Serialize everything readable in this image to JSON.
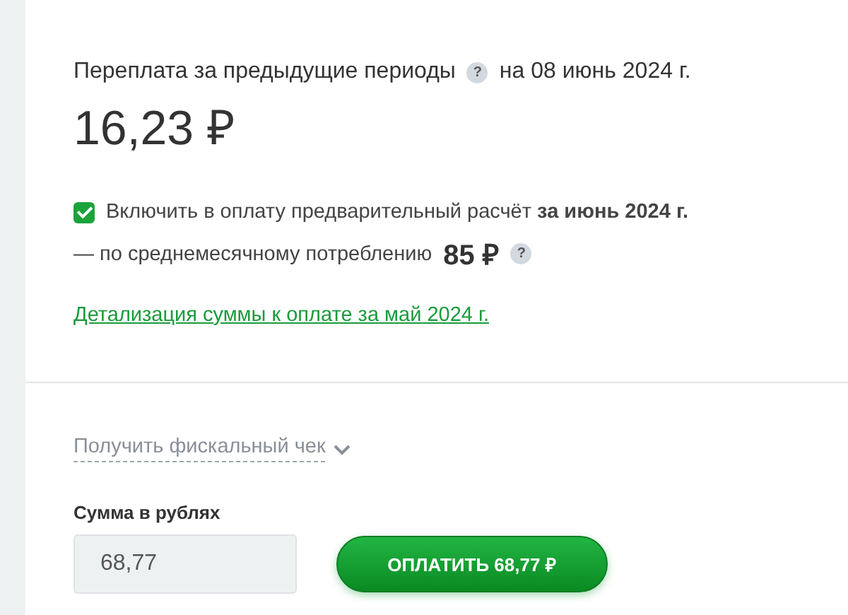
{
  "overpayment": {
    "title": "Переплата за предыдущие периоды",
    "date": "на 08 июнь 2024 г.",
    "amount": "16,23 ₽",
    "help": "?"
  },
  "prepay": {
    "checked": true,
    "label": "Включить в оплату предварительный расчёт **за июнь 2024 г.**",
    "note": "— по среднемесячному потреблению",
    "amount": "85 ₽",
    "help": "?"
  },
  "details_link": "Детализация суммы к оплате за май 2024 г.",
  "receipt": {
    "label": "Получить фискальный чек",
    "expanded": false
  },
  "sum": {
    "label": "Сумма в рублях",
    "value": "68,77"
  },
  "pay_button": "ОПЛАТИТЬ 68,77 ₽"
}
